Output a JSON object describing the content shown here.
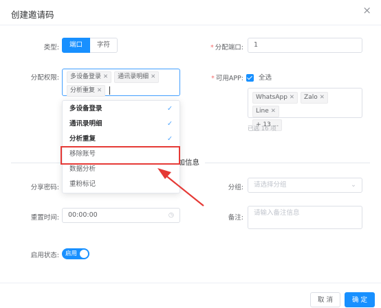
{
  "dialog": {
    "title": "创建邀请码",
    "close_icon": "×"
  },
  "form": {
    "type": {
      "label": "类型:",
      "options": [
        "端口",
        "字符"
      ],
      "selected": "端口"
    },
    "allocate_port": {
      "label": "分配端口:",
      "value": "1"
    },
    "permissions": {
      "label": "分配权限:",
      "tags": [
        "多设备登录",
        "通讯录明细",
        "分析重复"
      ],
      "dropdown": [
        {
          "label": "多设备登录",
          "selected": true
        },
        {
          "label": "通讯录明细",
          "selected": true
        },
        {
          "label": "分析重复",
          "selected": true
        },
        {
          "label": "移除账号",
          "selected": false
        },
        {
          "label": "数据分析",
          "selected": false
        },
        {
          "label": "重粉标记",
          "selected": false
        }
      ]
    },
    "apps": {
      "label": "可用APP:",
      "select_all_label": "全选",
      "tags": [
        "WhatsApp",
        "Zalo",
        "Line",
        "+ 13 ..."
      ],
      "selected_count_text": "已选 16 项"
    },
    "extra_section_title": "附加信息",
    "share_password": {
      "label": "分享密码:"
    },
    "group": {
      "label": "分组:",
      "placeholder": "请选择分组"
    },
    "reset_time": {
      "label": "重置时间:",
      "value": "00:00:00"
    },
    "remark": {
      "label": "备注:",
      "placeholder": "请输入备注信息"
    },
    "status": {
      "label": "启用状态:",
      "switch_text": "启用",
      "on": true
    }
  },
  "footer": {
    "cancel_label": "取 消",
    "confirm_label": "确 定"
  },
  "colors": {
    "primary": "#1890ff",
    "annotation": "#e53935"
  }
}
